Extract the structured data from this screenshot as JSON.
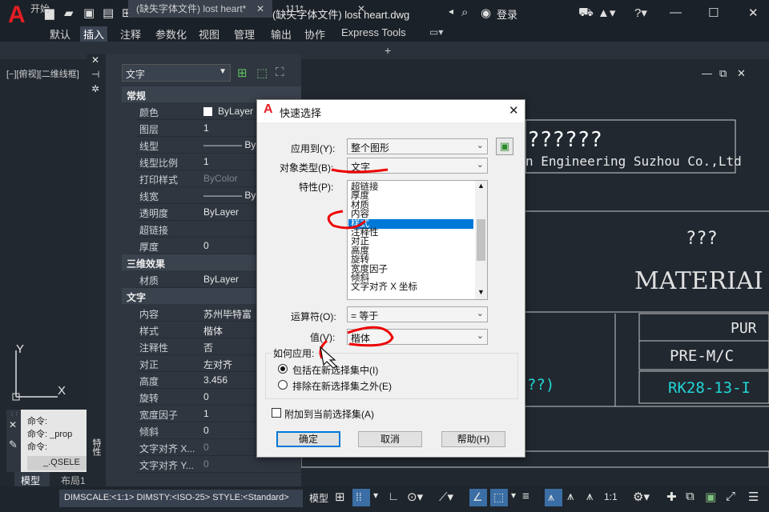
{
  "app": {
    "logo": "A",
    "title": "(缺失字体文件) lost heart.dwg",
    "login": "登录"
  },
  "ribbon_tabs": [
    "默认",
    "插入",
    "注释",
    "参数化",
    "视图",
    "管理",
    "输出",
    "协作",
    "Express Tools"
  ],
  "ribbon_active": 1,
  "doc_tabs": [
    {
      "label": "开始"
    },
    {
      "label": "(缺失字体文件) lost heart*"
    },
    {
      "label": "111*"
    }
  ],
  "viewport_label": "[−][俯视][二维线框]",
  "properties": {
    "type_combo": "文字",
    "sections": {
      "general": "常规",
      "3d": "三维效果",
      "text": "文字"
    },
    "general_rows": [
      {
        "k": "颜色",
        "v": "ByLayer"
      },
      {
        "k": "图层",
        "v": "1"
      },
      {
        "k": "线型",
        "v": "———— ByLayer"
      },
      {
        "k": "线型比例",
        "v": "1"
      },
      {
        "k": "打印样式",
        "v": "ByColor"
      },
      {
        "k": "线宽",
        "v": "———— ByLayer"
      },
      {
        "k": "透明度",
        "v": "ByLayer"
      },
      {
        "k": "超链接",
        "v": ""
      },
      {
        "k": "厚度",
        "v": "0"
      }
    ],
    "3d_rows": [
      {
        "k": "材质",
        "v": "ByLayer"
      }
    ],
    "text_rows": [
      {
        "k": "内容",
        "v": "苏州毕特富"
      },
      {
        "k": "样式",
        "v": "楷体"
      },
      {
        "k": "注释性",
        "v": "否"
      },
      {
        "k": "对正",
        "v": "左对齐"
      },
      {
        "k": "高度",
        "v": "3.456"
      },
      {
        "k": "旋转",
        "v": "0"
      },
      {
        "k": "宽度因子",
        "v": "1"
      },
      {
        "k": "倾斜",
        "v": "0"
      },
      {
        "k": "文字对齐 X...",
        "v": "0"
      },
      {
        "k": "文字对齐 Y...",
        "v": "0"
      }
    ],
    "side_label": "特性"
  },
  "command": {
    "lines": [
      "命令:",
      "命令:  _prop",
      "命令:"
    ],
    "input": "_.QSELE"
  },
  "model_tabs": [
    "模型",
    "布局1"
  ],
  "status_text": "DIMSCALE:<1:1> DIMSTY:<ISO-25> STYLE:<Standard>",
  "status_model": "模型",
  "status_scale": "1:1",
  "drawing": {
    "q1": "??????",
    "company": "n Engineering Suzhou Co.,Ltd",
    "q2": "???",
    "material": "MATERIAI",
    "pur": "PUR",
    "premc": "PRE-M/C",
    "rk": "RK28-13-I",
    "q3": "??)",
    "axis_y": "Y",
    "axis_x": "X"
  },
  "dialog": {
    "title": "快速选择",
    "apply_to_label": "应用到(Y):",
    "apply_to_value": "整个图形",
    "object_type_label": "对象类型(B):",
    "object_type_value": "文字",
    "properties_label": "特性(P):",
    "properties_list": [
      "超链接",
      "厚度",
      "材质",
      "内容",
      "样式",
      "注释性",
      "对正",
      "高度",
      "旋转",
      "宽度因子",
      "倾斜",
      "文字对齐 X 坐标"
    ],
    "properties_selected": 4,
    "operator_label": "运算符(O):",
    "operator_value": "= 等于",
    "value_label": "值(V):",
    "value_value": "楷体",
    "how_label": "如何应用:",
    "radio_include": "包括在新选择集中(I)",
    "radio_exclude": "排除在新选择集之外(E)",
    "append_label": "附加到当前选择集(A)",
    "ok": "确定",
    "cancel": "取消",
    "help": "帮助(H)"
  }
}
